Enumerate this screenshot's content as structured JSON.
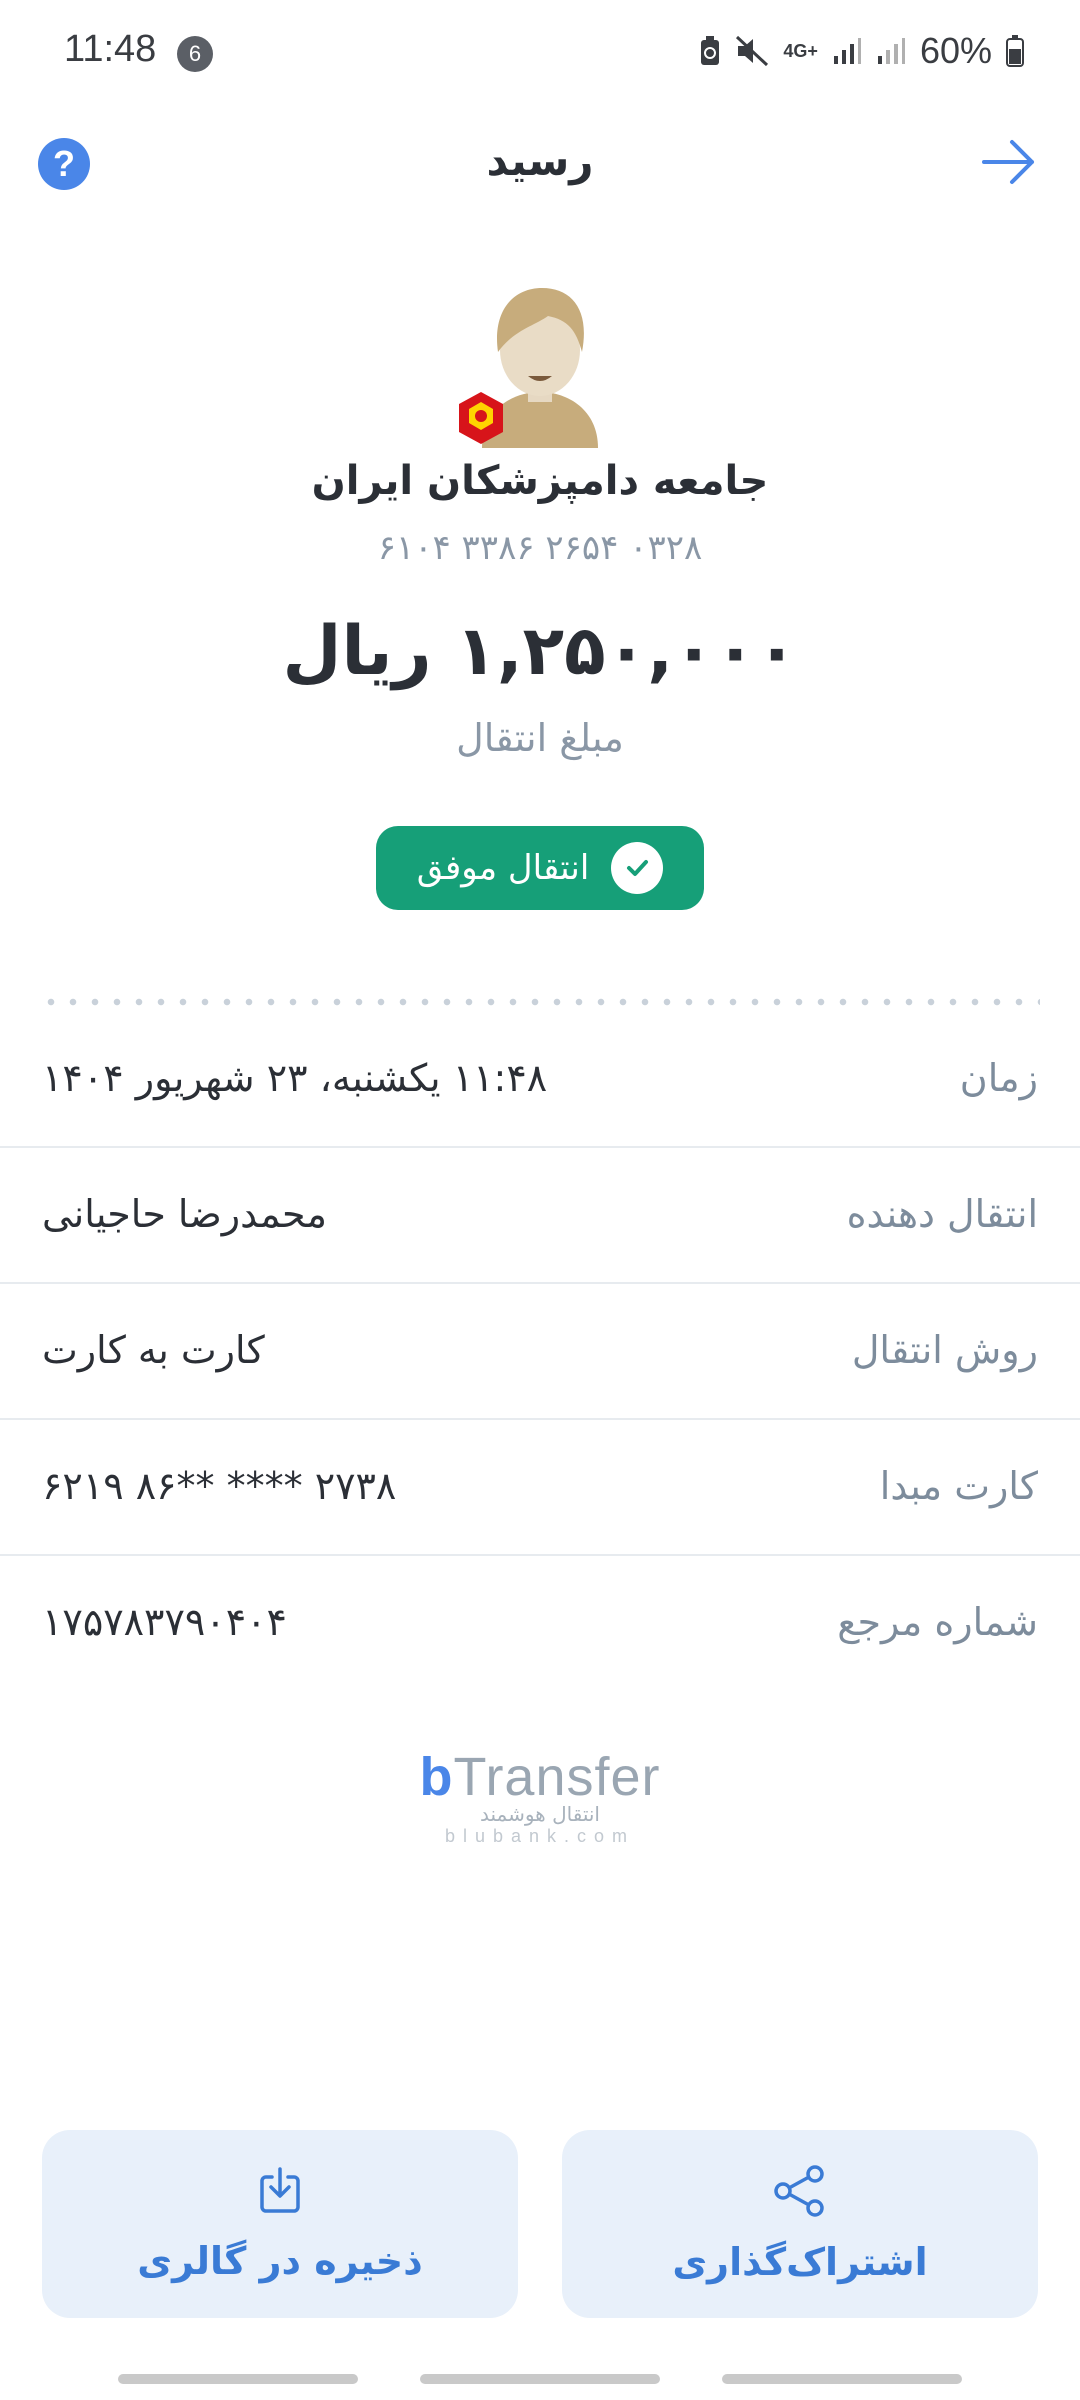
{
  "status_bar": {
    "time": "11:48",
    "notification_count": "6",
    "network": "4G+",
    "battery": "60%"
  },
  "header": {
    "title": "رسید",
    "help_label": "?"
  },
  "recipient": {
    "name": "جامعه دامپزشکان ایران",
    "card_number": "۶۱۰۴  ۳۳۸۶  ۲۶۵۴  ۰۳۲۸"
  },
  "amount": {
    "value": "۱,۲۵۰,۰۰۰ ریال",
    "label": "مبلغ انتقال"
  },
  "status": {
    "label": "انتقال موفق"
  },
  "details": [
    {
      "label": "زمان",
      "value": "۱۱:۴۸ یکشنبه، ۲۳ شهریور ۱۴۰۴"
    },
    {
      "label": "انتقال دهنده",
      "value": "محمدرضا حاجیانی"
    },
    {
      "label": "روش انتقال",
      "value": "کارت به کارت"
    },
    {
      "label": "کارت مبدا",
      "value": "۶۲۱۹  ۸۶**  ****  ۲۷۳۸"
    },
    {
      "label": "شماره مرجع",
      "value": "۱۷۵۷۸۳۷۹۰۴۰۴"
    }
  ],
  "brand": {
    "logo_b": "b",
    "logo_text": "Transfer",
    "tagline": "انتقال هوشمند",
    "site": "blubank.com"
  },
  "actions": {
    "save_label": "ذخیره در گالری",
    "share_label": "اشتراک‌گذاری"
  },
  "colors": {
    "accent": "#4a86e8",
    "success": "#169f78",
    "button_bg": "#e8f0fa"
  }
}
